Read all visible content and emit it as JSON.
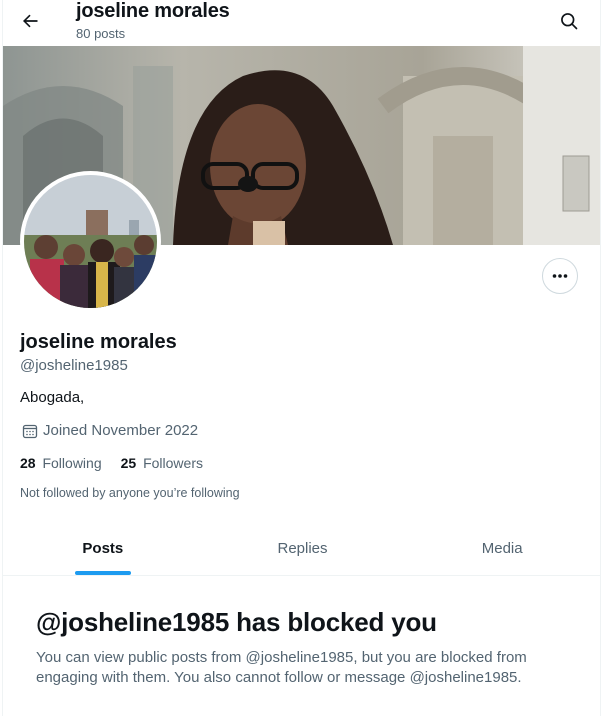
{
  "header": {
    "name": "joseline morales",
    "posts_count": "80 posts",
    "back_icon": "arrow-left-icon",
    "search_icon": "search-icon"
  },
  "profile": {
    "name": "joseline morales",
    "handle": "@josheline1985",
    "bio": "Abogada,",
    "joined": "Joined November 2022",
    "joined_icon": "calendar-icon",
    "following_count": "28",
    "following_label": "Following",
    "followers_count": "25",
    "followers_label": "Followers",
    "not_followed_text": "Not followed by anyone you’re following",
    "more_icon": "more-dots-icon"
  },
  "tabs": [
    {
      "label": "Posts",
      "active": true
    },
    {
      "label": "Replies",
      "active": false
    },
    {
      "label": "Media",
      "active": false
    }
  ],
  "blocked": {
    "title": "@josheline1985 has blocked you",
    "message": "You can view public posts from @josheline1985, but you are blocked from engaging with them. You also cannot follow or message @josheline1985."
  },
  "colors": {
    "accent": "#1d9bf0",
    "text_primary": "#0f1419",
    "text_secondary": "#536471",
    "border": "#eff3f4"
  }
}
